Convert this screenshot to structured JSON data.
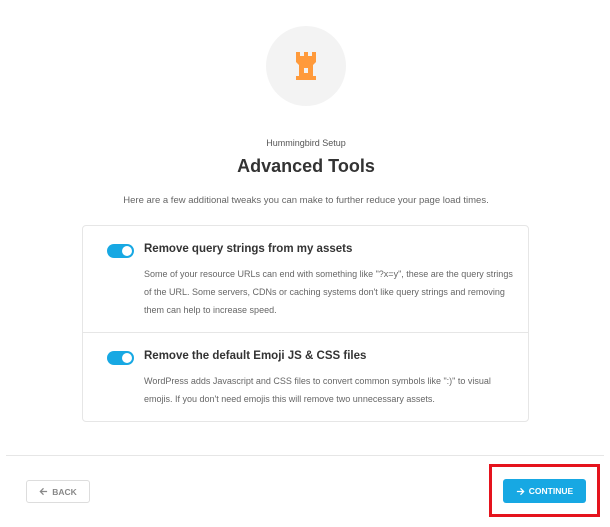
{
  "header": {
    "subtitle": "Hummingbird Setup",
    "title": "Advanced Tools",
    "description": "Here are a few additional tweaks you can make to further reduce your page load times."
  },
  "options": [
    {
      "title": "Remove query strings from my assets",
      "text": "Some of your resource URLs can end with something like \"?x=y\", these are the query strings of the URL. Some servers, CDNs or caching systems don't like query strings and removing them can help to increase speed.",
      "enabled": true
    },
    {
      "title": "Remove the default Emoji JS & CSS files",
      "text": "WordPress adds Javascript and CSS files to convert common symbols like \":)\" to visual emojis. If you don't need emojis this will remove two unnecessary assets.",
      "enabled": true
    }
  ],
  "footer": {
    "back_label": "BACK",
    "continue_label": "CONTINUE"
  },
  "colors": {
    "accent": "#17a8e3",
    "logo": "#ff9a3b",
    "highlight": "#e5131d"
  },
  "icons": {
    "logo": "castle-tower-icon",
    "back": "arrow-left-icon",
    "continue": "arrow-right-icon"
  }
}
